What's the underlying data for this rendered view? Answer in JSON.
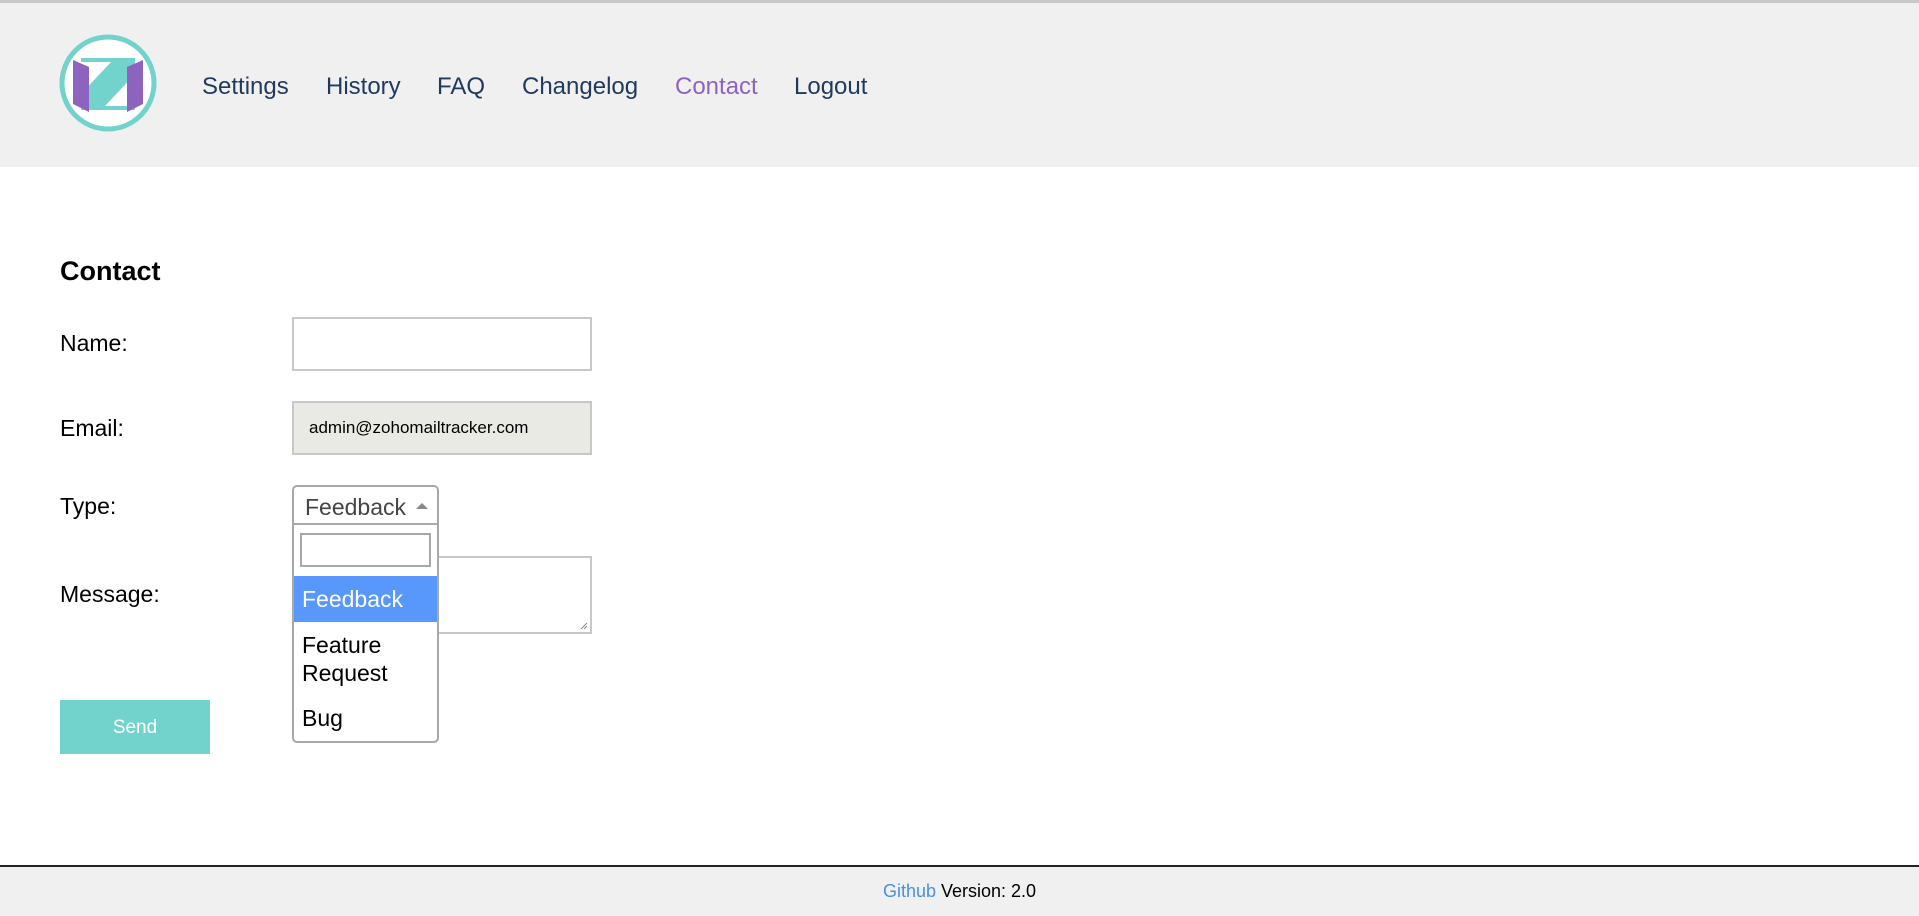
{
  "nav": {
    "items": [
      {
        "label": "Settings"
      },
      {
        "label": "History"
      },
      {
        "label": "FAQ"
      },
      {
        "label": "Changelog"
      },
      {
        "label": "Contact"
      },
      {
        "label": "Logout"
      }
    ]
  },
  "page": {
    "title": "Contact"
  },
  "form": {
    "name_label": "Name:",
    "name_value": "",
    "email_label": "Email:",
    "email_value": "admin@zohomailtracker.com",
    "type_label": "Type:",
    "type_selected": "Feedback",
    "type_options": [
      "Feedback",
      "Feature Request",
      "Bug"
    ],
    "message_label": "Message:",
    "send_label": "Send"
  },
  "footer": {
    "link": "Github",
    "version": "Version: 2.0"
  },
  "colors": {
    "header_bg": "#f0f0f0",
    "nav_text": "#1f3a5c",
    "nav_active": "#8e63bf",
    "button": "#72d3cd",
    "option_highlight": "#5897fb",
    "link": "#4a90e2"
  },
  "icons": {
    "logo": "z-logo-icon",
    "select_arrow": "triangle-up-icon",
    "resize": "resize-grip-icon"
  }
}
